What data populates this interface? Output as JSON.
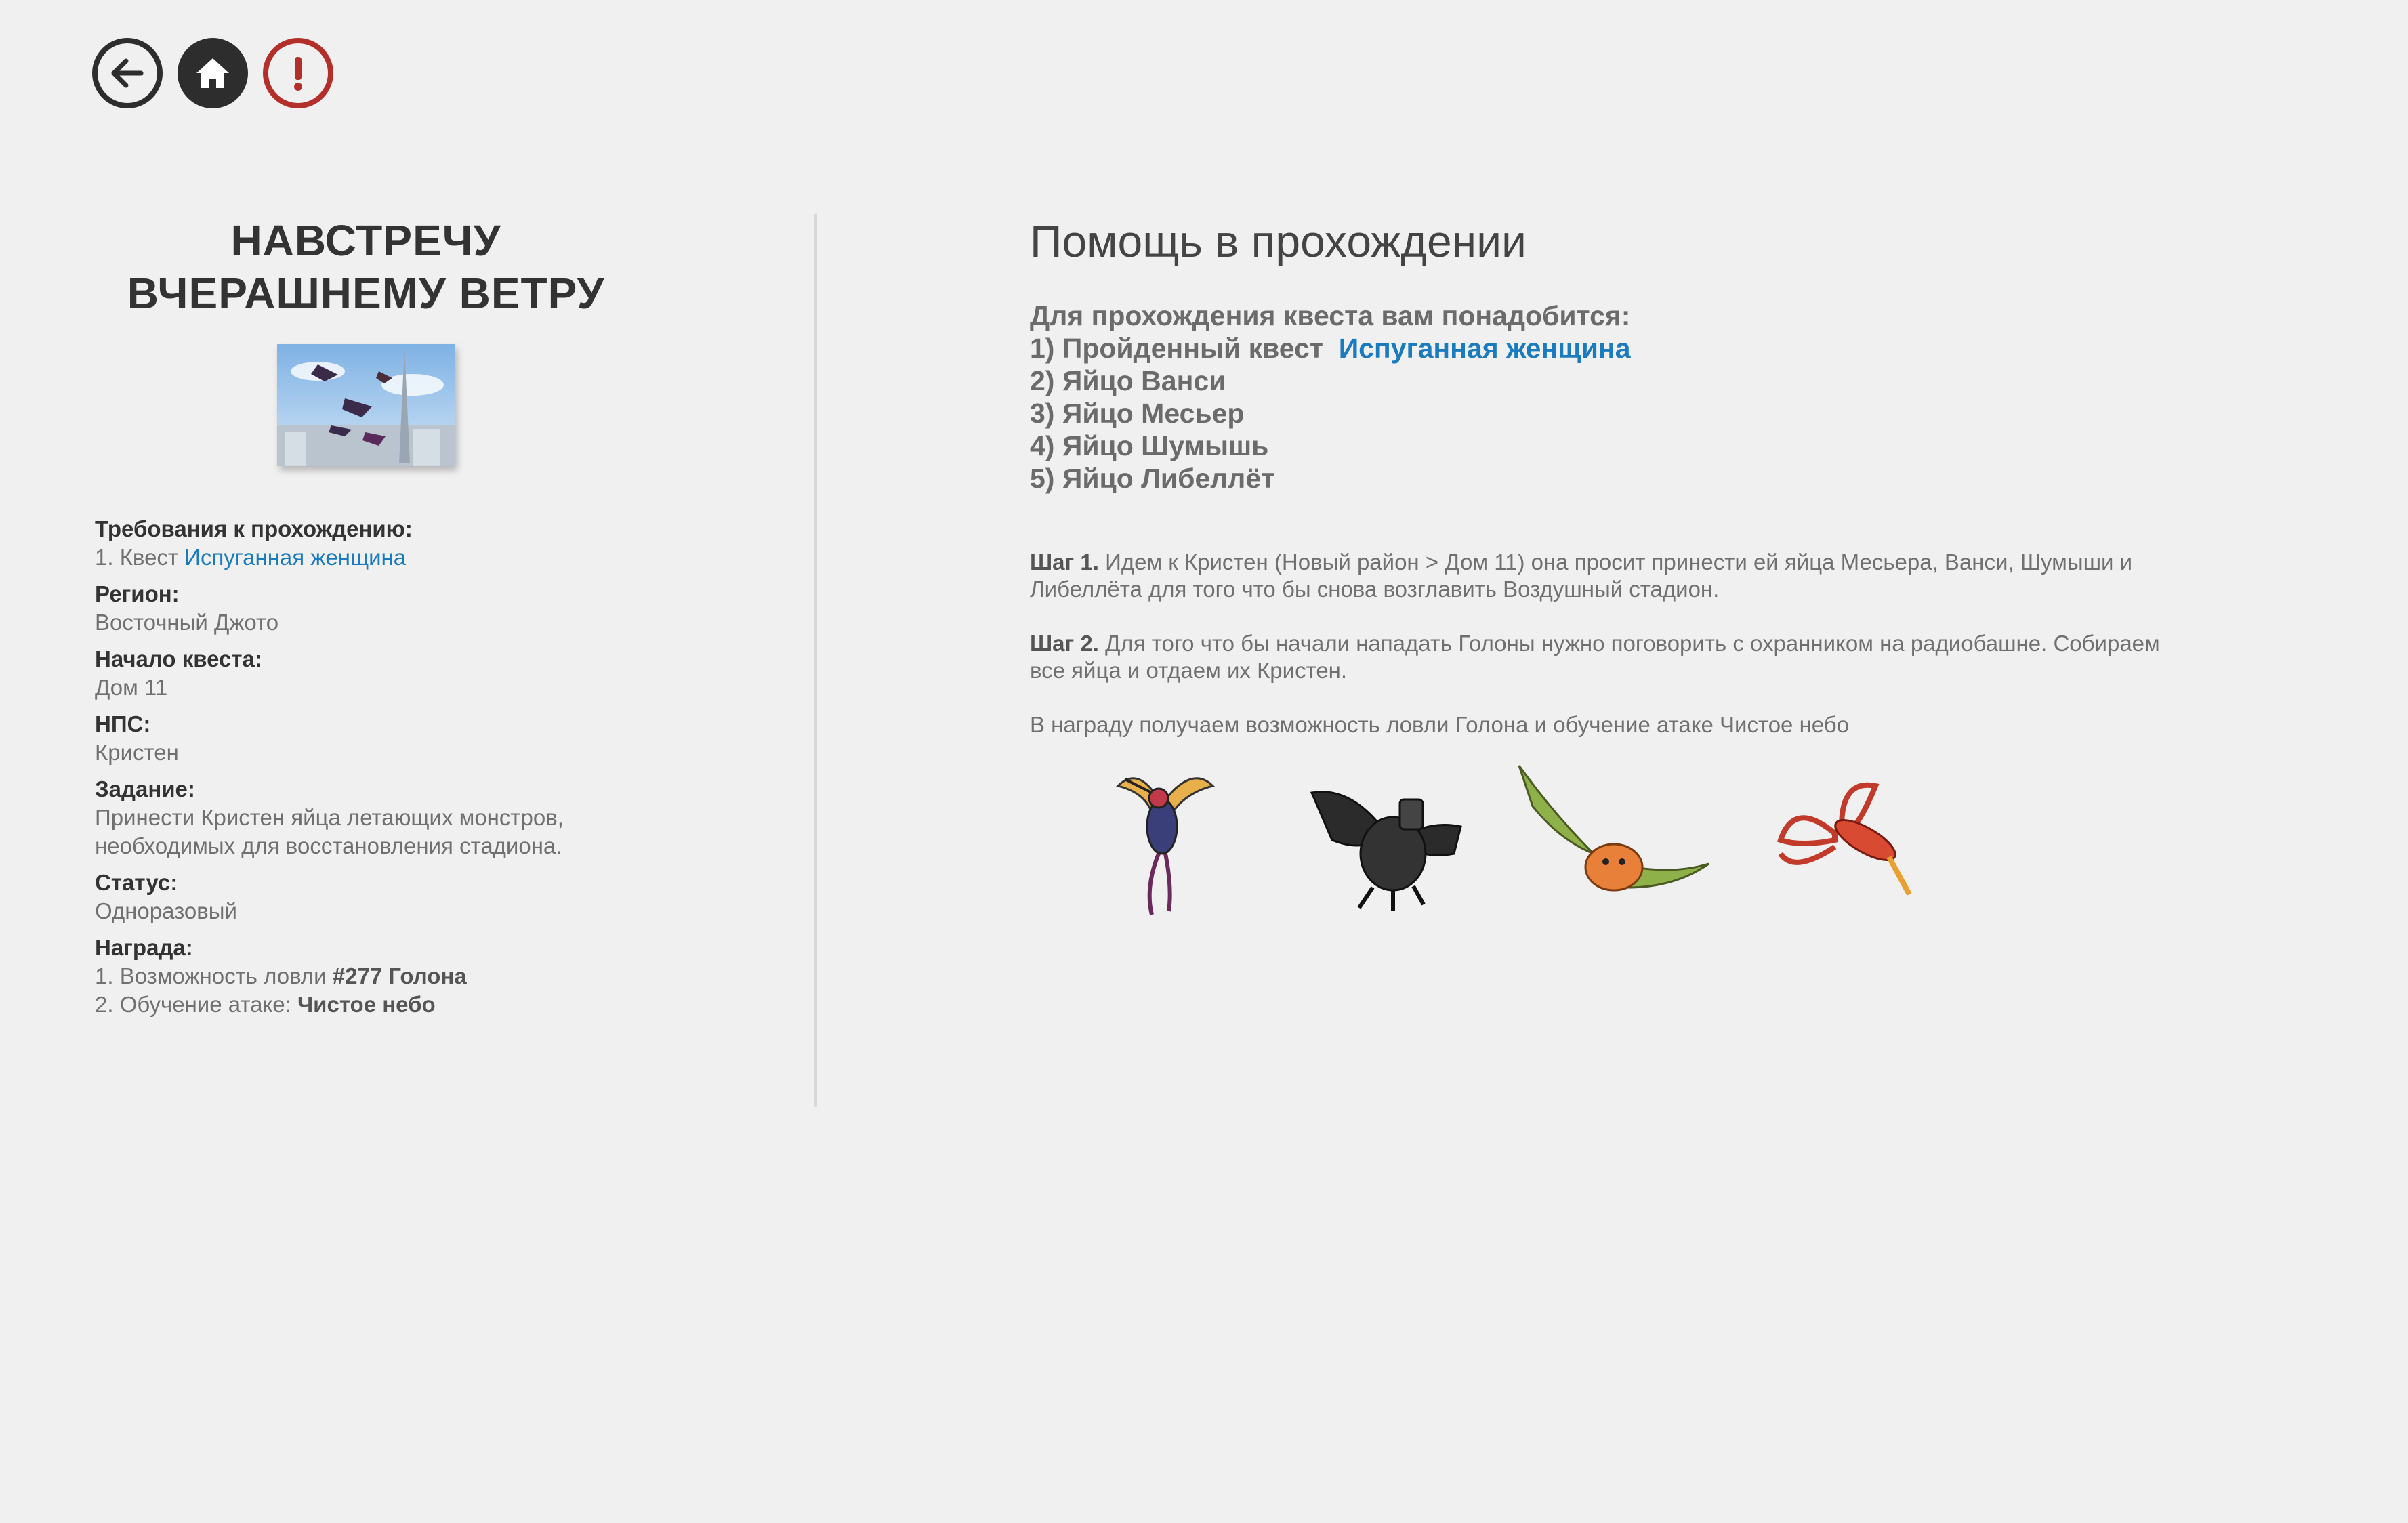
{
  "nav": {
    "back_icon": "arrow-left-icon",
    "home_icon": "home-icon",
    "alert_icon": "exclamation-icon",
    "alert_color": "#b3302a"
  },
  "quest": {
    "title_line1": "НАВСТРЕЧУ",
    "title_line2": "ВЧЕРАШНЕМУ ВЕТРУ",
    "requirements_label": "Требования к прохождению:",
    "requirements_prefix": "1. Квест",
    "requirements_link": "Испуганная женщина",
    "region_label": "Регион:",
    "region": "Восточный Джото",
    "start_label": "Начало квеста:",
    "start": "Дом 11",
    "npc_label": "НПС:",
    "npc": "Кристен",
    "task_label": "Задание:",
    "task": "Принести Кристен яйца летающих монстров, необходимых для восстановления стадиона.",
    "status_label": "Статус:",
    "status": "Одноразовый",
    "reward_label": "Награда:",
    "reward1_prefix": "1. Возможность ловли",
    "reward1_bold": "#277 Голона",
    "reward2_prefix": "2. Обучение атаке:",
    "reward2_bold": "Чистое небо"
  },
  "help": {
    "title": "Помощь в прохождении",
    "needs_intro": "Для прохождения квеста вам понадобится:",
    "need1_prefix": "1) Пройденный квест",
    "need1_link": "Испуганная женщина",
    "need2": "2) Яйцо Ванси",
    "need3": "3) Яйцо Месьер",
    "need4": "4) Яйцо Шумышь",
    "need5": "5) Яйцо Либеллёт",
    "step1_label": "Шаг 1.",
    "step1_text": "Идем к Кристен (Новый район > Дом 11) она просит принести ей яйца Месьера, Ванси, Шумыши и Либеллёта для того что бы снова возглавить Воздушный стадион.",
    "step2_label": "Шаг 2.",
    "step2_text": "Для того что бы начали нападать Голоны нужно поговорить с охранником на радиобашне. Собираем все яйца и отдаем их Кристен.",
    "reward_text": "В награду получаем возможность ловли Голона и обучение атаке Чистое небо"
  },
  "colors": {
    "background": "#f0f0f0",
    "link": "#1a7bbf",
    "heading": "#333333",
    "text": "#707070"
  }
}
